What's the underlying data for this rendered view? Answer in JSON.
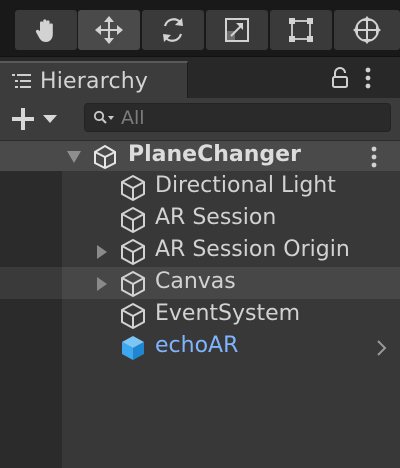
{
  "toolbar": {
    "tools": [
      {
        "icon": "hand-tool-icon",
        "active": false
      },
      {
        "icon": "move-tool-icon",
        "active": true
      },
      {
        "icon": "rotate-tool-icon",
        "active": false
      },
      {
        "icon": "scale-tool-icon",
        "active": false
      },
      {
        "icon": "rect-tool-icon",
        "active": false
      },
      {
        "icon": "transform-tool-icon",
        "active": false
      }
    ]
  },
  "hierarchy": {
    "tab_label": "Hierarchy",
    "search_placeholder": "All",
    "scene": {
      "name": "PlaneChanger"
    },
    "items": [
      {
        "label": "Directional Light",
        "expandable": false,
        "highlighted": false,
        "prefab": false
      },
      {
        "label": "AR Session",
        "expandable": false,
        "highlighted": false,
        "prefab": false
      },
      {
        "label": "AR Session Origin",
        "expandable": true,
        "highlighted": false,
        "prefab": false
      },
      {
        "label": "Canvas",
        "expandable": true,
        "highlighted": true,
        "prefab": false
      },
      {
        "label": "EventSystem",
        "expandable": false,
        "highlighted": false,
        "prefab": false
      },
      {
        "label": "echoAR",
        "expandable": false,
        "highlighted": false,
        "prefab": true
      }
    ]
  },
  "colors": {
    "prefab_text": "#7fb5ff",
    "prefab_icon": "#3ea8ee"
  }
}
